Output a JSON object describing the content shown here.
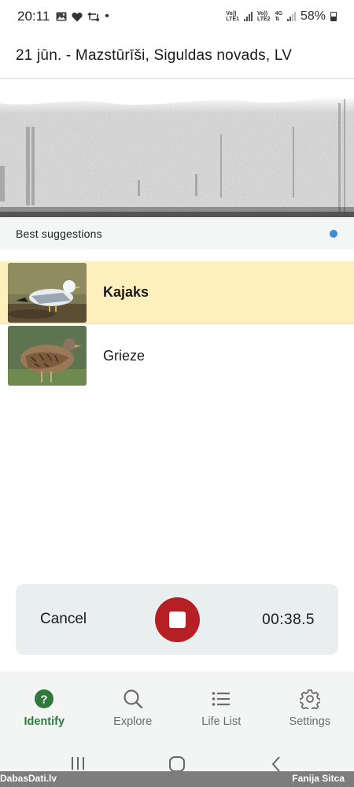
{
  "status_bar": {
    "time": "20:11",
    "battery": "58%",
    "net1": [
      "Vo))",
      "LTE1"
    ],
    "net2": [
      "Vo))",
      "LTE2"
    ],
    "net3": "4G",
    "left_icons": [
      "gallery-icon",
      "heart-icon",
      "retweet-icon",
      "dot-icon"
    ]
  },
  "header": {
    "title": "21 jūn. - Mazstūrīši, Siguldas novads, LV"
  },
  "suggestions": {
    "title": "Best suggestions",
    "indicator_color": "#3d8cd6",
    "items": [
      {
        "name": "Kajaks",
        "selected": true
      },
      {
        "name": "Grieze",
        "selected": false
      }
    ]
  },
  "recording": {
    "cancel_label": "Cancel",
    "timer": "00:38.5",
    "stop_color": "#b61f24"
  },
  "bottom_nav": {
    "accent": "#2f7a3b",
    "items": [
      {
        "label": "Identify",
        "icon": "help-circle-icon",
        "active": true
      },
      {
        "label": "Explore",
        "icon": "search-icon",
        "active": false
      },
      {
        "label": "Life List",
        "icon": "list-icon",
        "active": false
      },
      {
        "label": "Settings",
        "icon": "gear-icon",
        "active": false
      }
    ]
  },
  "watermark": {
    "left": "DabasDati.lv",
    "right": "Fanija Sitca"
  }
}
